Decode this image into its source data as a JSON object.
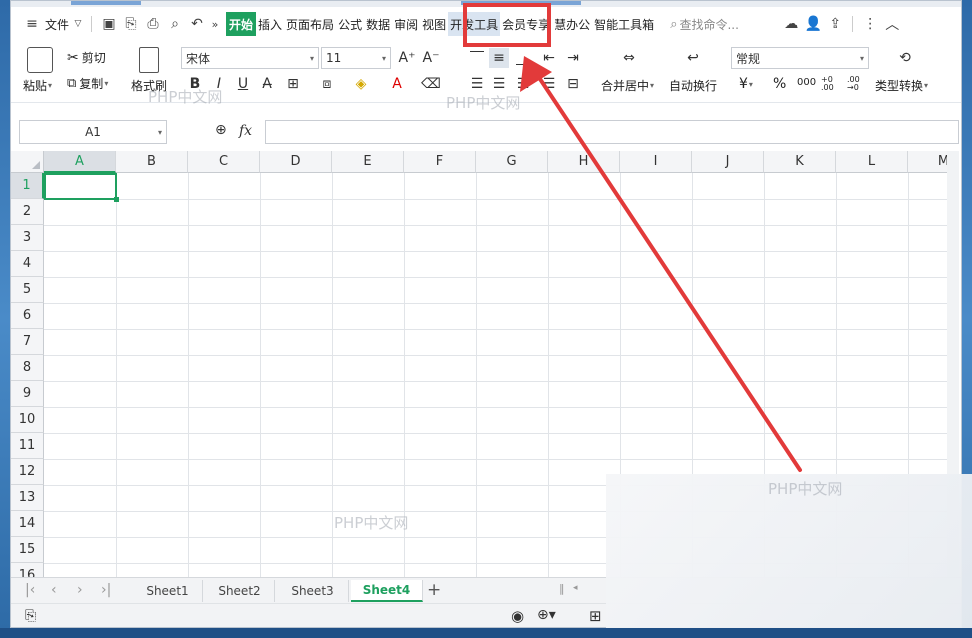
{
  "menu": {
    "file": "文件",
    "more": "»",
    "tabs": [
      "开始",
      "插入",
      "页面布局",
      "公式",
      "数据",
      "审阅",
      "视图",
      "开发工具",
      "会员专享",
      "慧办公",
      "智能工具箱"
    ],
    "search_placeholder": "查找命令..."
  },
  "ribbon": {
    "paste": "粘贴",
    "cut": "剪切",
    "copy": "复制",
    "format_painter": "格式刷",
    "font_name": "宋体",
    "font_size": "11",
    "merge_center": "合并居中",
    "wrap_text": "自动换行",
    "number_format": "常规",
    "currency": "¥",
    "percent": "%",
    "thousands": "000",
    "increase_decimal": "+0 .00",
    "decrease_decimal": ".00 →0",
    "type_convert": "类型转换"
  },
  "formula_bar": {
    "name_box": "A1",
    "fx": "fx"
  },
  "grid": {
    "columns": [
      "A",
      "B",
      "C",
      "D",
      "E",
      "F",
      "G",
      "H",
      "I",
      "J",
      "K",
      "L",
      "M"
    ],
    "rows": [
      "1",
      "2",
      "3",
      "4",
      "5",
      "6",
      "7",
      "8",
      "9",
      "10",
      "11",
      "12",
      "13",
      "14",
      "15",
      "16"
    ],
    "active_cell": "A1"
  },
  "sheets": [
    "Sheet1",
    "Sheet2",
    "Sheet3",
    "Sheet4"
  ],
  "active_sheet": "Sheet4",
  "watermark": "PHP中文网",
  "colors": {
    "accent": "#1ea05f",
    "highlight_box": "#e23a3a"
  }
}
